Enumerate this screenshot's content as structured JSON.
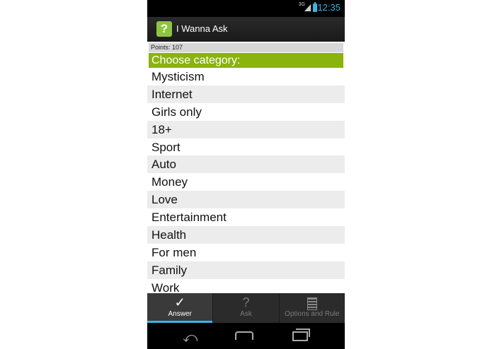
{
  "status_bar": {
    "network": "3G",
    "time": "12:35"
  },
  "app": {
    "icon_glyph": "?",
    "title": "I Wanna Ask"
  },
  "points": {
    "text": "Points:  107"
  },
  "category": {
    "header": "Choose category:",
    "items": [
      "Mysticism",
      "Internet",
      "Girls only",
      "18+",
      "Sport",
      "Auto",
      "Money",
      "Love",
      "Entertainment",
      "Health",
      "For men",
      "Family",
      "Work"
    ]
  },
  "tabs": [
    {
      "icon": "check-icon",
      "glyph": "✓",
      "label": "Answer",
      "selected": true
    },
    {
      "icon": "question-icon",
      "glyph": "?",
      "label": "Ask",
      "selected": false
    },
    {
      "icon": "document-icon",
      "glyph": "",
      "label": "Options and Rule",
      "selected": false
    }
  ],
  "colors": {
    "accent": "#8ab30c",
    "status_accent": "#33b5e5",
    "app_icon": "#8cc63f"
  }
}
